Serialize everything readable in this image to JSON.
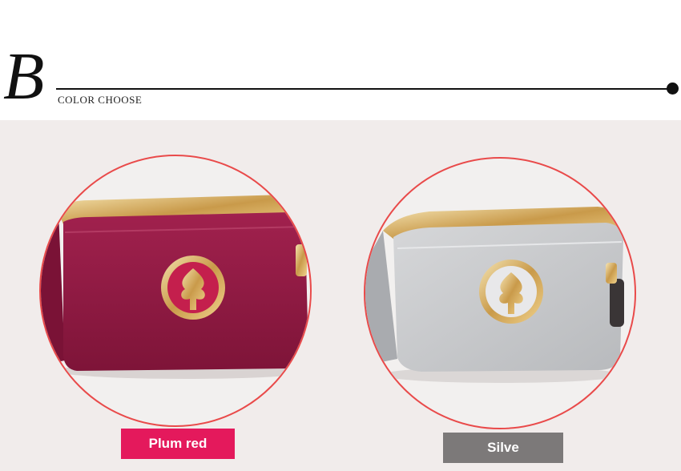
{
  "header": {
    "letter": "B",
    "subtitle": "COLOR CHOOSE"
  },
  "options": [
    {
      "label": "Plum red",
      "product_color": "#8e1a43",
      "label_bg": "#e4195c"
    },
    {
      "label": "Silve",
      "product_color": "#c8c9cb",
      "label_bg": "#7c7979"
    }
  ],
  "colors": {
    "circle_border": "#e94a4a",
    "panel_bg": "#f1eceb"
  }
}
